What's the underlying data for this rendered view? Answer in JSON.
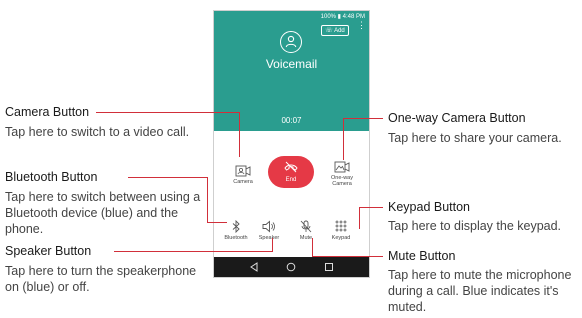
{
  "phone": {
    "status": "100% ▮ 4:48 PM",
    "add_label": "Add",
    "call_name": "Voicemail",
    "timer": "00:07",
    "buttons": {
      "camera": "Camera",
      "end": "End",
      "oneway_line1": "One-way",
      "oneway_line2": "Camera",
      "bluetooth": "Bluetooth",
      "speaker": "Speaker",
      "mute": "Mute",
      "keypad": "Keypad"
    }
  },
  "callouts": {
    "camera": {
      "title": "Camera Button",
      "desc": "Tap here to switch to a video call."
    },
    "bluetooth": {
      "title": "Bluetooth Button",
      "desc": "Tap here to switch between using a Bluetooth device (blue) and the phone."
    },
    "speaker": {
      "title": "Speaker Button",
      "desc": "Tap here to turn the speakerphone on (blue) or off."
    },
    "oneway": {
      "title": "One-way Camera Button",
      "desc": "Tap here to share your camera."
    },
    "keypad": {
      "title": "Keypad Button",
      "desc": "Tap here to display the keypad."
    },
    "mute": {
      "title": "Mute Button",
      "desc": "Tap here to mute the microphone during a call. Blue indicates it's muted."
    }
  },
  "colors": {
    "teal": "#2a9d8f",
    "end_red": "#e53946",
    "callout_line": "#d12f3a"
  }
}
